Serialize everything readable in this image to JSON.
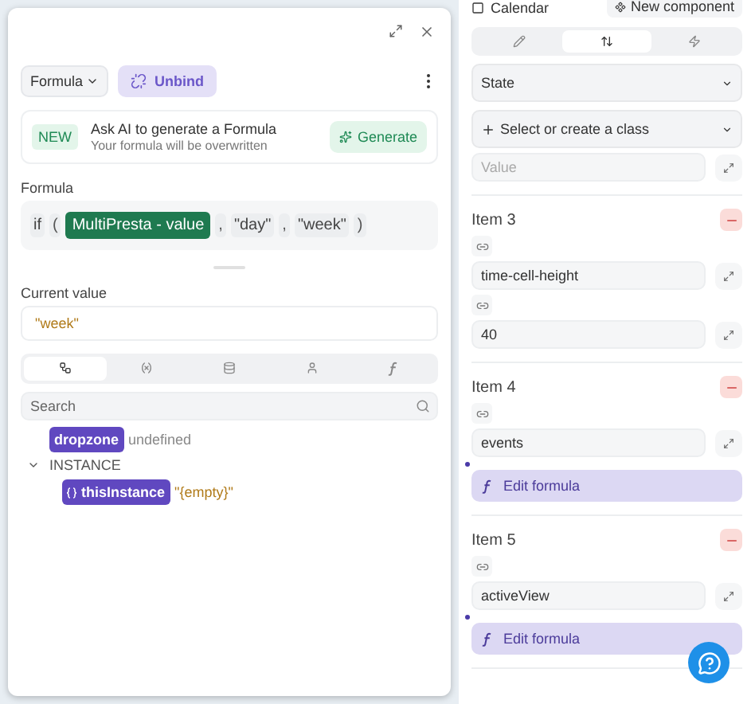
{
  "formula_panel": {
    "mode_dropdown": "Formula",
    "unbind_button": "Unbind",
    "ai_banner": {
      "badge": "NEW",
      "title": "Ask AI to generate a Formula",
      "subtitle": "Your formula will be overwritten",
      "button": "Generate"
    },
    "formula_label": "Formula",
    "formula_tokens": [
      {
        "kind": "keyword",
        "text": "if"
      },
      {
        "kind": "punct",
        "text": "("
      },
      {
        "kind": "variable",
        "text": "MultiPresta - value"
      },
      {
        "kind": "punct",
        "text": ","
      },
      {
        "kind": "string",
        "text": "\"day\""
      },
      {
        "kind": "punct",
        "text": ","
      },
      {
        "kind": "string",
        "text": "\"week\""
      },
      {
        "kind": "punct",
        "text": ")"
      }
    ],
    "current_value_label": "Current value",
    "current_value": "\"week\"",
    "explorer_tabs": [
      {
        "selected": true
      },
      {
        "selected": false
      },
      {
        "selected": false
      },
      {
        "selected": false
      },
      {
        "selected": false
      }
    ],
    "search": {
      "placeholder": "Search"
    },
    "variables": [
      {
        "name": "dropzone",
        "value": "undefined"
      }
    ],
    "groups": [
      {
        "label": "INSTANCE",
        "expanded": true,
        "children": [
          {
            "name": "thisInstance",
            "value": "\"{empty}\""
          }
        ]
      }
    ]
  },
  "right_panel": {
    "component": "Calendar",
    "new_component_button": "New component",
    "tabs": [
      {
        "selected": false
      },
      {
        "selected": true
      },
      {
        "selected": false
      }
    ],
    "state_select": "State",
    "class_select": "Select or create a class",
    "partial_field": "Value",
    "items": [
      {
        "title": "Item 3",
        "key": "time-cell-height",
        "value": {
          "kind": "text",
          "text": "40"
        }
      },
      {
        "title": "Item 4",
        "key": "events",
        "value": {
          "kind": "formula",
          "text": "Edit formula"
        }
      },
      {
        "title": "Item 5",
        "key": "activeView",
        "value": {
          "kind": "formula",
          "text": "Edit formula"
        }
      }
    ]
  }
}
